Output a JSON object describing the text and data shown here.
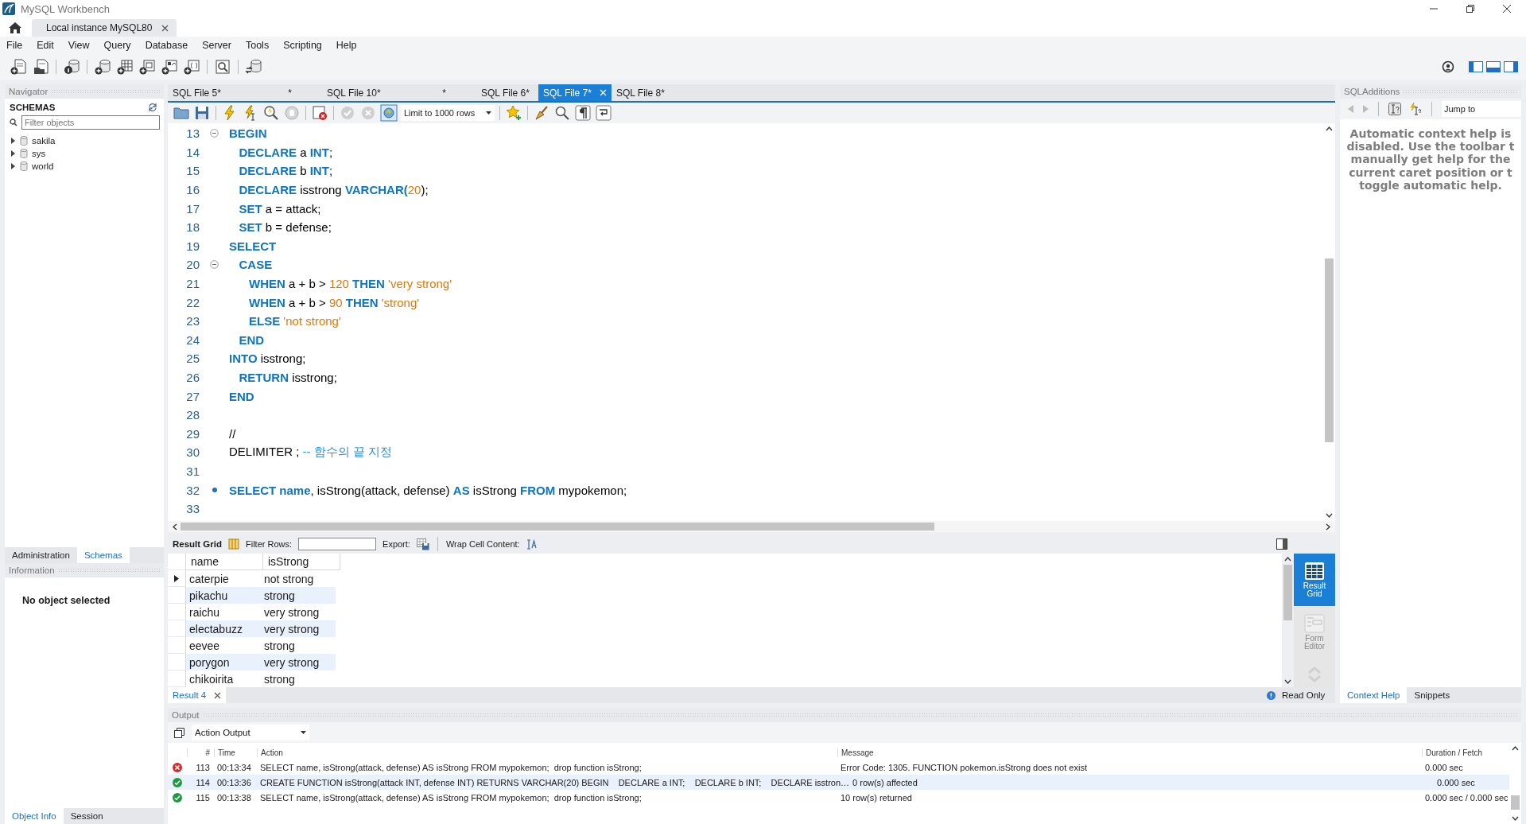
{
  "window": {
    "title": "MySQL Workbench"
  },
  "connection_tabs": [
    {
      "label": "Local instance MySQL80",
      "selected": true
    }
  ],
  "menu": [
    "File",
    "Edit",
    "View",
    "Query",
    "Database",
    "Server",
    "Tools",
    "Scripting",
    "Help"
  ],
  "navigator": {
    "title": "Navigator",
    "section": "SCHEMAS",
    "filter_placeholder": "Filter objects",
    "schemas": [
      {
        "name": "sakila",
        "expanded": false
      },
      {
        "name": "sys",
        "expanded": false
      },
      {
        "name": "world",
        "expanded": false
      }
    ]
  },
  "sidebar_tabs": [
    {
      "label": "Administration",
      "selected": false
    },
    {
      "label": "Schemas",
      "selected": true
    }
  ],
  "information": {
    "title": "Information",
    "message": "No object selected"
  },
  "info_tabs": [
    {
      "label": "Object Info",
      "selected": true
    },
    {
      "label": "Session",
      "selected": false
    }
  ],
  "editor_tabs": [
    {
      "label": "SQL File 5*",
      "mark": "*",
      "selected": false
    },
    {
      "label": "SQL File 10*",
      "mark": "*",
      "selected": false
    },
    {
      "label": "SQL File 6*",
      "selected": false
    },
    {
      "label": "SQL File 7*",
      "selected": true
    },
    {
      "label": "SQL File 8*",
      "selected": false
    }
  ],
  "editor_toolbar": {
    "limit": "Limit to 1000 rows",
    "autocommit": true,
    "commit_enabled": false
  },
  "code": [
    {
      "number": "13",
      "fold": true,
      "current": false,
      "tokens": [
        {
          "text": "BEGIN",
          "kind": "keyword"
        }
      ]
    },
    {
      "number": "14",
      "fold": false,
      "current": false,
      "tokens": [
        {
          "text": "   DECLARE",
          "kind": "keyword"
        },
        {
          "text": " a ",
          "kind": "plain"
        },
        {
          "text": "INT",
          "kind": "keyword"
        },
        {
          "text": ";",
          "kind": "plain"
        }
      ]
    },
    {
      "number": "15",
      "fold": false,
      "current": false,
      "tokens": [
        {
          "text": "   DECLARE",
          "kind": "keyword"
        },
        {
          "text": " b ",
          "kind": "plain"
        },
        {
          "text": "INT",
          "kind": "keyword"
        },
        {
          "text": ";",
          "kind": "plain"
        }
      ]
    },
    {
      "number": "16",
      "fold": false,
      "current": false,
      "tokens": [
        {
          "text": "   DECLARE",
          "kind": "keyword"
        },
        {
          "text": " isstrong ",
          "kind": "plain"
        },
        {
          "text": "VARCHAR(",
          "kind": "keyword"
        },
        {
          "text": "20",
          "kind": "number"
        },
        {
          "text": ");",
          "kind": "plain"
        }
      ]
    },
    {
      "number": "17",
      "fold": false,
      "current": false,
      "tokens": [
        {
          "text": "   SET",
          "kind": "keyword"
        },
        {
          "text": " a = attack;",
          "kind": "plain"
        }
      ]
    },
    {
      "number": "18",
      "fold": false,
      "current": false,
      "tokens": [
        {
          "text": "   SET",
          "kind": "keyword"
        },
        {
          "text": " b = defense;",
          "kind": "plain"
        }
      ]
    },
    {
      "number": "19",
      "fold": false,
      "current": false,
      "tokens": [
        {
          "text": "SELECT",
          "kind": "keyword"
        }
      ]
    },
    {
      "number": "20",
      "fold": true,
      "current": false,
      "tokens": [
        {
          "text": "   CASE",
          "kind": "keyword"
        }
      ]
    },
    {
      "number": "21",
      "fold": false,
      "current": false,
      "tokens": [
        {
          "text": "      WHEN",
          "kind": "keyword"
        },
        {
          "text": " a + b > ",
          "kind": "plain"
        },
        {
          "text": "120",
          "kind": "number"
        },
        {
          "text": " THEN ",
          "kind": "keyword"
        },
        {
          "text": "'very strong'",
          "kind": "string"
        }
      ]
    },
    {
      "number": "22",
      "fold": false,
      "current": false,
      "tokens": [
        {
          "text": "      WHEN",
          "kind": "keyword"
        },
        {
          "text": " a + b > ",
          "kind": "plain"
        },
        {
          "text": "90",
          "kind": "number"
        },
        {
          "text": " THEN ",
          "kind": "keyword"
        },
        {
          "text": "'strong'",
          "kind": "string"
        }
      ]
    },
    {
      "number": "23",
      "fold": false,
      "current": false,
      "tokens": [
        {
          "text": "      ELSE ",
          "kind": "keyword"
        },
        {
          "text": "'not strong'",
          "kind": "string"
        }
      ]
    },
    {
      "number": "24",
      "fold": false,
      "current": false,
      "tokens": [
        {
          "text": "   END",
          "kind": "keyword"
        }
      ]
    },
    {
      "number": "25",
      "fold": false,
      "current": false,
      "tokens": [
        {
          "text": "INTO",
          "kind": "keyword"
        },
        {
          "text": " isstrong;",
          "kind": "plain"
        }
      ]
    },
    {
      "number": "26",
      "fold": false,
      "current": false,
      "tokens": [
        {
          "text": "   RETURN",
          "kind": "keyword"
        },
        {
          "text": " isstrong;",
          "kind": "plain"
        }
      ]
    },
    {
      "number": "27",
      "fold": false,
      "current": false,
      "tokens": [
        {
          "text": "END",
          "kind": "keyword"
        }
      ]
    },
    {
      "number": "28",
      "fold": false,
      "current": false
    },
    {
      "number": "29",
      "fold": false,
      "current": false,
      "tokens": [
        {
          "text": "//",
          "kind": "plain"
        }
      ]
    },
    {
      "number": "30",
      "fold": false,
      "current": false,
      "tokens": [
        {
          "text": "DELIMITER ; ",
          "kind": "plain"
        },
        {
          "text": "-- 함수의 끝 지정",
          "kind": "comment"
        }
      ]
    },
    {
      "number": "31",
      "fold": false,
      "current": false
    },
    {
      "number": "32",
      "fold": false,
      "current": true,
      "tokens": [
        {
          "text": "SELECT name",
          "kind": "keyword"
        },
        {
          "text": ", isStrong(attack, defense) ",
          "kind": "plain"
        },
        {
          "text": "AS",
          "kind": "keyword"
        },
        {
          "text": " isStrong ",
          "kind": "plain"
        },
        {
          "text": "FROM",
          "kind": "keyword"
        },
        {
          "text": " mypokemon;",
          "kind": "plain"
        }
      ]
    },
    {
      "number": "33",
      "fold": false,
      "current": false
    }
  ],
  "result": {
    "grid_label": "Result Grid",
    "filter_label": "Filter Rows:",
    "export_label": "Export:",
    "wrap_label": "Wrap Cell Content:",
    "columns": [
      "name",
      "isStrong"
    ],
    "rows": [
      {
        "cells": [
          "caterpie",
          "not strong"
        ],
        "current": true
      },
      {
        "cells": [
          "pikachu",
          "strong"
        ],
        "current": false
      },
      {
        "cells": [
          "raichu",
          "very strong"
        ],
        "current": false
      },
      {
        "cells": [
          "electabuzz",
          "very strong"
        ],
        "current": false
      },
      {
        "cells": [
          "eevee",
          "strong"
        ],
        "current": false
      },
      {
        "cells": [
          "porygon",
          "very strong"
        ],
        "current": false
      },
      {
        "cells": [
          "chikoirita",
          "strong"
        ],
        "current": false
      }
    ],
    "tabs": [
      {
        "label": "Result 4",
        "selected": true
      }
    ],
    "views": [
      {
        "label": "Result Grid",
        "kind": "grid",
        "selected": true
      },
      {
        "label": "Form Editor",
        "kind": "form",
        "selected": false
      }
    ],
    "status": "Read Only"
  },
  "sql_additions": {
    "title": "SQLAdditions",
    "jump_to": "Jump to",
    "help_lines": [
      "Automatic context help is",
      "disabled. Use the toolbar t",
      "manually get help for the",
      "current caret position or t",
      "toggle automatic help."
    ],
    "tabs": [
      {
        "label": "Context Help",
        "selected": true
      },
      {
        "label": "Snippets",
        "selected": false
      }
    ]
  },
  "output": {
    "title": "Output",
    "mode": "Action Output",
    "columns": [
      "#",
      "Time",
      "Action",
      "Message",
      "Duration / Fetch"
    ],
    "rows": [
      {
        "error": true,
        "selected": false,
        "number": "113",
        "time": "00:13:34",
        "action": "SELECT name, isStrong(attack, defense) AS isStrong FROM mypokemon;  drop function isStrong;",
        "message": "Error Code: 1305. FUNCTION pokemon.isStrong does not exist",
        "duration": "0.000 sec"
      },
      {
        "error": false,
        "selected": true,
        "number": "114",
        "time": "00:13:36",
        "action": "CREATE FUNCTION isStrong(attack INT, defense INT) RETURNS VARCHAR(20) BEGIN    DECLARE a INT;    DECLARE b INT;    DECLARE isstron…",
        "message": "0 row(s) affected",
        "duration": "0.000 sec"
      },
      {
        "error": false,
        "selected": false,
        "number": "115",
        "time": "00:13:38",
        "action": "SELECT name, isStrong(attack, defense) AS isStrong FROM mypokemon;  drop function isStrong;",
        "message": "10 row(s) returned",
        "duration": "0.000 sec / 0.000 sec"
      }
    ]
  }
}
